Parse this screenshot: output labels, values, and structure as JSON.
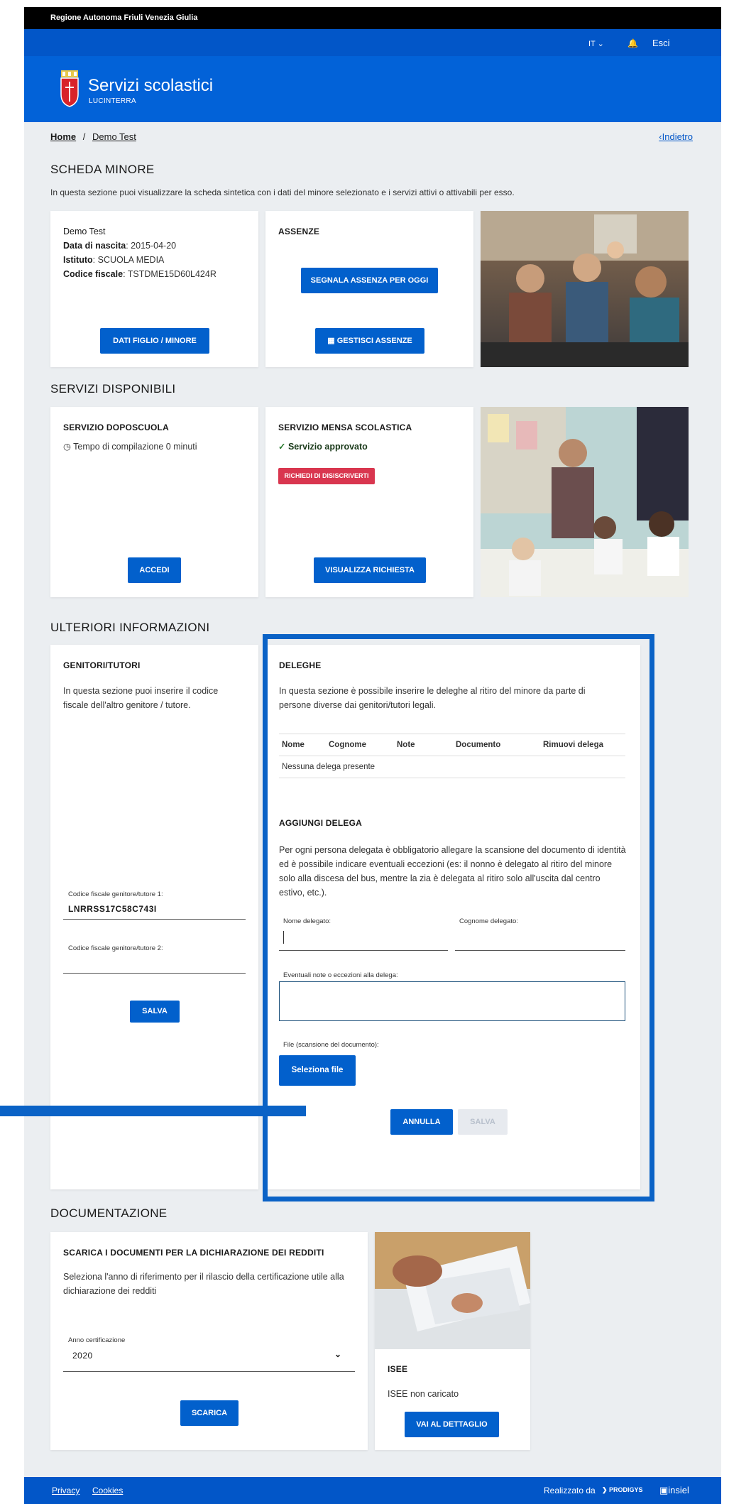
{
  "topbar": {
    "region": "Regione Autonoma Friuli Venezia Giulia"
  },
  "navbar": {
    "language": "IT ⌄",
    "bell_icon": "bell-icon",
    "logout": "Esci"
  },
  "header": {
    "title": "Servizi scolastici",
    "subtitle": "LUCINTERRA"
  },
  "breadcrumb": {
    "home": "Home",
    "separator": "/",
    "current": "Demo Test",
    "back": "Indietro"
  },
  "scheda": {
    "title": "SCHEDA MINORE",
    "intro": "In questa sezione puoi visualizzare la scheda sintetica con i dati del minore selezionato e i servizi attivi o attivabili per esso.",
    "minor": {
      "name": "Demo Test",
      "dob_label": "Data di nascita",
      "dob_value": ": 2015-04-20",
      "school_label": "Istituto",
      "school_value": ": SCUOLA MEDIA",
      "cf_label": "Codice fiscale",
      "cf_value": ": TSTDME15D60L424R",
      "button": "DATI FIGLIO / MINORE"
    },
    "absences": {
      "title": "ASSENZE",
      "report_button": "SEGNALA ASSENZA PER OGGI",
      "manage_button": "GESTISCI ASSENZE",
      "calendar_icon": "calendar-icon"
    }
  },
  "servizi": {
    "title": "SERVIZI DISPONIBILI",
    "doposcuola": {
      "title": "SERVIZIO DOPOSCUOLA",
      "status": "Tempo di compilazione 0 minuti",
      "clock_icon": "clock-icon",
      "button": "ACCEDI"
    },
    "mensa": {
      "title": "SERVIZIO MENSA SCOLASTICA",
      "status": "Servizio approvato",
      "check_icon": "check-circle-icon",
      "badge": "RICHIEDI DI DISISCRIVERTI",
      "button": "VISUALIZZA RICHIESTA"
    }
  },
  "ulteriori": {
    "title": "ULTERIORI INFORMAZIONI",
    "genitori": {
      "title": "GENITORI/TUTORI",
      "text": "In questa sezione puoi inserire il codice fiscale dell'altro genitore / tutore.",
      "cf1_label": "Codice fiscale genitore/tutore 1:",
      "cf1_value": "LNRRSS17C58C743I",
      "cf2_label": "Codice fiscale genitore/tutore 2:",
      "cf2_value": "",
      "save": "SALVA"
    },
    "deleghe": {
      "title": "DELEGHE",
      "text": "In questa sezione è possibile inserire le deleghe al ritiro del minore da parte di persone diverse dai genitori/tutori legali.",
      "columns": [
        "Nome",
        "Cognome",
        "Note",
        "Documento",
        "Rimuovi delega"
      ],
      "empty": "Nessuna delega presente",
      "add_title": "AGGIUNGI DELEGA",
      "add_text": "Per ogni persona delegata è obbligatorio allegare la scansione del documento di identità ed è possibile indicare eventuali eccezioni (es: il nonno è delegato al ritiro del minore solo alla discesa del bus, mentre la zia è delegata al ritiro solo all'uscita dal centro estivo, etc.).",
      "nome_label": "Nome delegato:",
      "nome_value": "",
      "cognome_label": "Cognome delegato:",
      "cognome_value": "",
      "note_label": "Eventuali note o eccezioni alla delega:",
      "note_value": "",
      "file_label": "File (scansione del documento):",
      "file_button": "Seleziona file",
      "cancel": "ANNULLA",
      "save": "SALVA"
    }
  },
  "documentazione": {
    "title": "DOCUMENTAZIONE",
    "redditi": {
      "title": "SCARICA I DOCUMENTI PER LA DICHIARAZIONE DEI REDDITI",
      "text": "Seleziona l'anno di riferimento per il rilascio della certificazione utile alla dichiarazione dei redditi",
      "year_label": "Anno certificazione",
      "year_value": "2020",
      "button": "SCARICA"
    },
    "isee": {
      "title": "ISEE",
      "status": "ISEE non caricato",
      "button": "VAI AL DETTAGLIO"
    }
  },
  "footer": {
    "privacy": "Privacy",
    "cookies": "Cookies",
    "credits": "Realizzato da",
    "brand1": "PRODIGYS",
    "brand2": "insiel"
  },
  "colors": {
    "primary": "#0260cc",
    "header": "#0262d8",
    "danger": "#d9364f",
    "success": "#2e7d32",
    "highlight": "#0a62c6"
  }
}
